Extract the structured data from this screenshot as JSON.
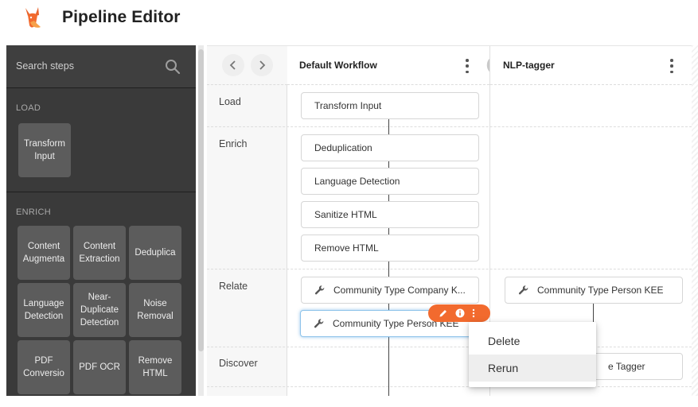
{
  "app": {
    "title": "Pipeline Editor",
    "logo_icon": "fox-logo",
    "brand_color": "#f26a2e"
  },
  "sidebar": {
    "search_placeholder": "Search steps",
    "sections": [
      {
        "title": "LOAD",
        "tiles": [
          "Transform\nInput"
        ]
      },
      {
        "title": "ENRICH",
        "tiles": [
          "Content\nAugmenta",
          "Content\nExtraction",
          "Deduplica",
          "Language\nDetection",
          "Near-\nDuplicate\nDetection",
          "Noise\nRemoval",
          "PDF\nConversio",
          "PDF OCR",
          "Remove\nHTML"
        ]
      }
    ]
  },
  "board": {
    "columns": [
      {
        "title": "Default Workflow",
        "toggle_label": "o"
      },
      {
        "title": "NLP-tagger"
      }
    ],
    "rows": [
      "Load",
      "Enrich",
      "Relate",
      "Discover"
    ],
    "steps": {
      "load": [
        "Transform Input"
      ],
      "enrich": [
        "Deduplication",
        "Language Detection",
        "Sanitize HTML",
        "Remove HTML"
      ],
      "relate_default": [
        "Community Type Company K...",
        "Community Type Person KEE"
      ],
      "relate_nlp": [
        "Community Type Person KEE"
      ],
      "discover_nlp": [
        "e Tagger"
      ]
    },
    "selected_step": "Community Type Person KEE"
  },
  "context_menu": {
    "items": [
      "Delete",
      "Rerun"
    ],
    "hovered": "Rerun"
  }
}
